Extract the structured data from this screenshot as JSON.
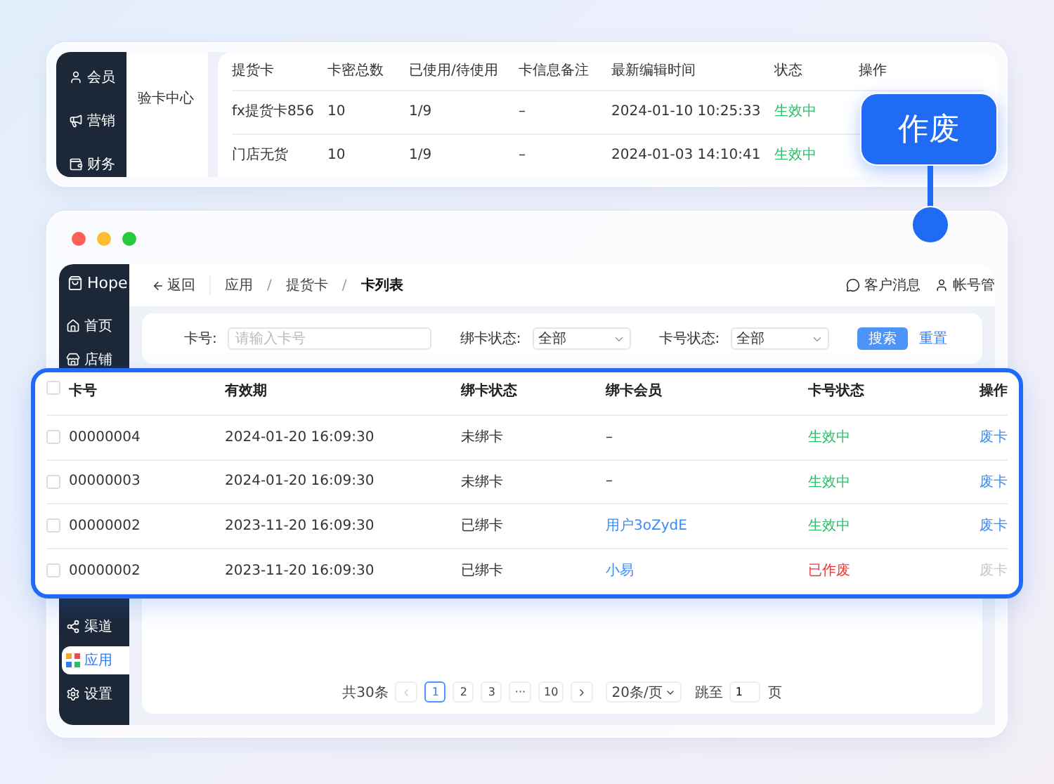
{
  "top_preview": {
    "sidebar": [
      {
        "label": "会员"
      },
      {
        "label": "营销"
      },
      {
        "label": "财务"
      }
    ],
    "submenu": [
      "验卡中心"
    ],
    "columns": [
      "提货卡",
      "卡密总数",
      "已使用/待使用",
      "卡信息备注",
      "最新编辑时间",
      "状态",
      "操作"
    ],
    "rows": [
      {
        "cells": [
          "fx提货卡856",
          "10",
          "1/9",
          "–",
          "2024-01-10 10:25:33"
        ],
        "status": "生效中"
      },
      {
        "cells": [
          "门店无货",
          "10",
          "1/9",
          "–",
          "2024-01-03 14:10:41"
        ],
        "status": "生效中"
      }
    ]
  },
  "callout": {
    "label": "作废"
  },
  "window": {
    "sidebar": {
      "logo": "Hope",
      "top_items": [
        {
          "label": "首页",
          "selected": false
        },
        {
          "label": "店铺",
          "selected": false
        }
      ],
      "bottom_items": [
        {
          "label": "渠道",
          "selected": false
        },
        {
          "label": "应用",
          "selected": true
        },
        {
          "label": "设置",
          "selected": false
        }
      ]
    },
    "back": "返回",
    "breadcrumb": [
      {
        "label": "应用",
        "kind": "link"
      },
      {
        "label": "/",
        "kind": "separator"
      },
      {
        "label": "提货卡",
        "kind": "link"
      },
      {
        "label": "/",
        "kind": "separator"
      },
      {
        "label": "卡列表",
        "kind": "current"
      }
    ],
    "header_actions": [
      {
        "label": "客户消息"
      },
      {
        "label": "帐号管"
      }
    ],
    "filters": [
      {
        "kind": "input",
        "label": "卡号:",
        "placeholder": "请输入卡号"
      },
      {
        "kind": "select",
        "label": "绑卡状态:",
        "value": "全部"
      },
      {
        "kind": "select",
        "label": "卡号状态:",
        "value": "全部"
      }
    ],
    "search_button": "搜索",
    "reset_link": "重置",
    "pagination": {
      "total": "共30条",
      "pages": [
        {
          "label": "1",
          "selected": true
        },
        {
          "label": "2",
          "selected": false
        },
        {
          "label": "3",
          "selected": false
        },
        {
          "label": "···",
          "selected": false
        },
        {
          "label": "10",
          "selected": false
        }
      ],
      "page_size": "20条/页",
      "jump_label": "跳至",
      "jump_value": "1",
      "jump_suffix": "页"
    }
  },
  "highlight_table": {
    "select_all_checked": false,
    "columns": [
      "卡号",
      "有效期",
      "绑卡状态",
      "绑卡会员",
      "卡号状态",
      "操作"
    ],
    "rows": [
      {
        "checked": false,
        "card": "00000004",
        "valid": "2024-01-20 16:09:30",
        "bind": "未绑卡",
        "member": "–",
        "member_linked": false,
        "status": "生效中",
        "voided": false,
        "action": "废卡"
      },
      {
        "checked": false,
        "card": "00000003",
        "valid": "2024-01-20 16:09:30",
        "bind": "未绑卡",
        "member": "–",
        "member_linked": false,
        "status": "生效中",
        "voided": false,
        "action": "废卡"
      },
      {
        "checked": false,
        "card": "00000002",
        "valid": "2023-11-20 16:09:30",
        "bind": "已绑卡",
        "member": "用户3oZydE",
        "member_linked": true,
        "status": "生效中",
        "voided": false,
        "action": "废卡"
      },
      {
        "checked": false,
        "card": "00000002",
        "valid": "2023-11-20 16:09:30",
        "bind": "已绑卡",
        "member": "小易",
        "member_linked": true,
        "status": "已作废",
        "voided": true,
        "action": "废卡"
      }
    ]
  }
}
